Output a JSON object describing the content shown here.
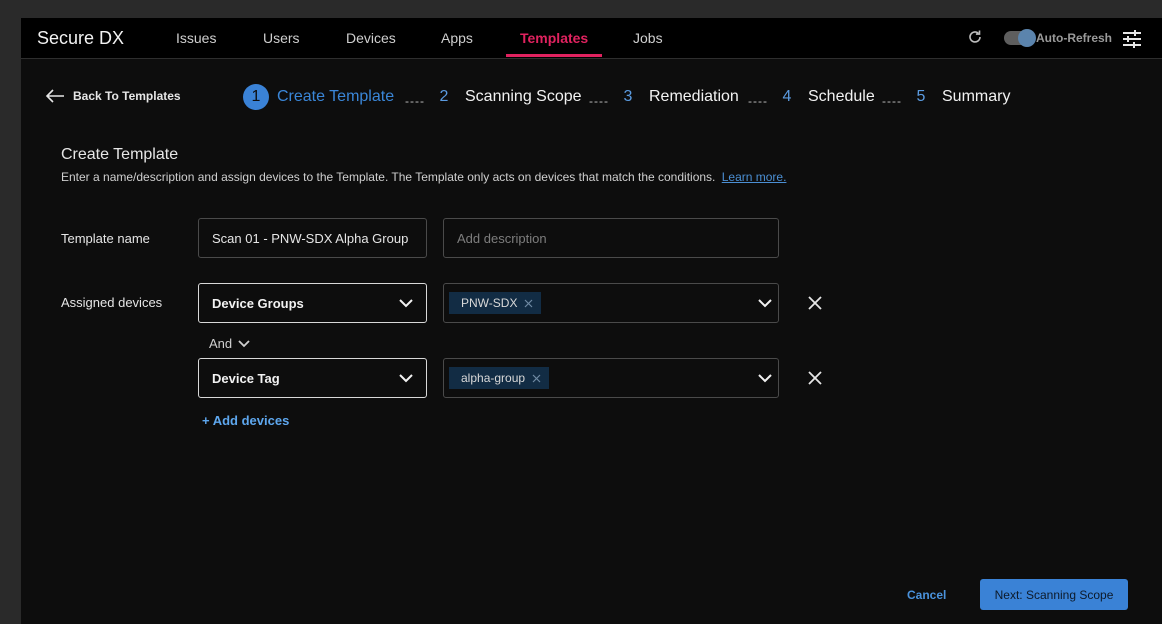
{
  "app": {
    "title": "Secure DX"
  },
  "nav": {
    "items": [
      {
        "label": "Issues"
      },
      {
        "label": "Users"
      },
      {
        "label": "Devices"
      },
      {
        "label": "Apps"
      },
      {
        "label": "Templates",
        "active": true
      },
      {
        "label": "Jobs"
      }
    ],
    "auto_refresh_label": "Auto-Refresh",
    "auto_refresh_on": true
  },
  "stepper": {
    "back_label": "Back To Templates",
    "steps": [
      {
        "num": "1",
        "label": "Create Template",
        "current": true
      },
      {
        "num": "2",
        "label": "Scanning Scope"
      },
      {
        "num": "3",
        "label": "Remediation"
      },
      {
        "num": "4",
        "label": "Schedule"
      },
      {
        "num": "5",
        "label": "Summary"
      }
    ],
    "separator": "----"
  },
  "form": {
    "heading": "Create Template",
    "description": "Enter a name/description and assign devices to the Template. The Template only acts on devices that match the conditions.",
    "learn_more": "Learn more.",
    "template_name_label": "Template name",
    "template_name_value": "Scan 01 - PNW-SDX Alpha Group",
    "description_placeholder": "Add description",
    "assigned_devices_label": "Assigned devices",
    "conditions": [
      {
        "type": "Device Groups",
        "values": [
          "PNW-SDX"
        ]
      },
      {
        "type": "Device Tag",
        "values": [
          "alpha-group"
        ]
      }
    ],
    "operator": "And",
    "add_devices_label": "+ Add devices"
  },
  "footer": {
    "cancel_label": "Cancel",
    "next_label": "Next: Scanning Scope"
  },
  "colors": {
    "accent": "#3a82d6",
    "nav_active": "#e0225f",
    "background": "#0d0d0d"
  }
}
